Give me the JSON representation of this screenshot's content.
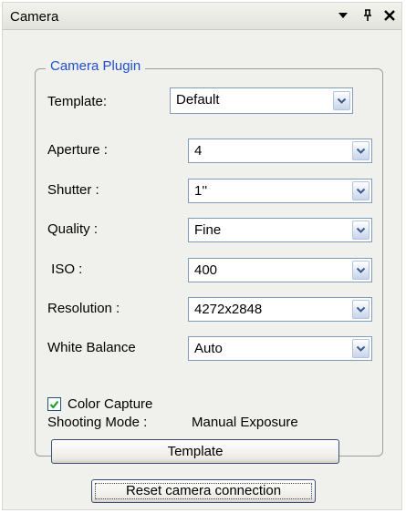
{
  "window": {
    "title": "Camera"
  },
  "group": {
    "title": "Camera Plugin"
  },
  "template_field": {
    "label": "Template:",
    "value": "Default"
  },
  "settings": [
    {
      "label": "Aperture :",
      "value": "4"
    },
    {
      "label": "Shutter :",
      "value": "1''"
    },
    {
      "label": "Quality :",
      "value": "Fine"
    },
    {
      "label": " ISO :",
      "value": "400"
    },
    {
      "label": "Resolution :",
      "value": "4272x2848"
    },
    {
      "label": "White Balance",
      "value": "Auto"
    }
  ],
  "color_capture": {
    "label": "Color Capture",
    "checked": true
  },
  "shooting_mode": {
    "label": "Shooting Mode :",
    "value": "Manual Exposure"
  },
  "buttons": {
    "template": "Template",
    "reset": "Reset camera connection"
  },
  "colors": {
    "group_title": "#1f4fd6",
    "check": "#21a121",
    "panel_bg": "#f0f0ec"
  },
  "icons": {
    "titlebar": [
      "dropdown-arrow-icon",
      "pin-icon",
      "close-icon"
    ],
    "combo_arrow": "chevron-down-icon",
    "check": "checkmark-icon"
  }
}
